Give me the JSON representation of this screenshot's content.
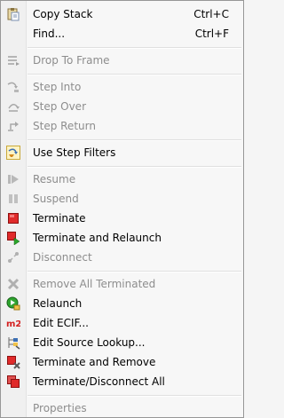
{
  "menu": {
    "copy_stack": {
      "label": "Copy Stack",
      "shortcut": "Ctrl+C"
    },
    "find": {
      "label": "Find...",
      "shortcut": "Ctrl+F"
    },
    "drop_to_frame": {
      "label": "Drop To Frame"
    },
    "step_into": {
      "label": "Step Into"
    },
    "step_over": {
      "label": "Step Over"
    },
    "step_return": {
      "label": "Step Return"
    },
    "use_step_filters": {
      "label": "Use Step Filters"
    },
    "resume": {
      "label": "Resume"
    },
    "suspend": {
      "label": "Suspend"
    },
    "terminate": {
      "label": "Terminate"
    },
    "terminate_relaunch": {
      "label": "Terminate and Relaunch"
    },
    "disconnect": {
      "label": "Disconnect"
    },
    "remove_all_terminated": {
      "label": "Remove All Terminated"
    },
    "relaunch": {
      "label": "Relaunch"
    },
    "edit_ecif": {
      "label": "Edit ECIF..."
    },
    "edit_source_lookup": {
      "label": "Edit Source Lookup..."
    },
    "terminate_remove": {
      "label": "Terminate and Remove"
    },
    "terminate_disconnect_all": {
      "label": "Terminate/Disconnect All"
    },
    "properties": {
      "label": "Properties"
    }
  },
  "icons": {
    "m2_text": "m2"
  }
}
